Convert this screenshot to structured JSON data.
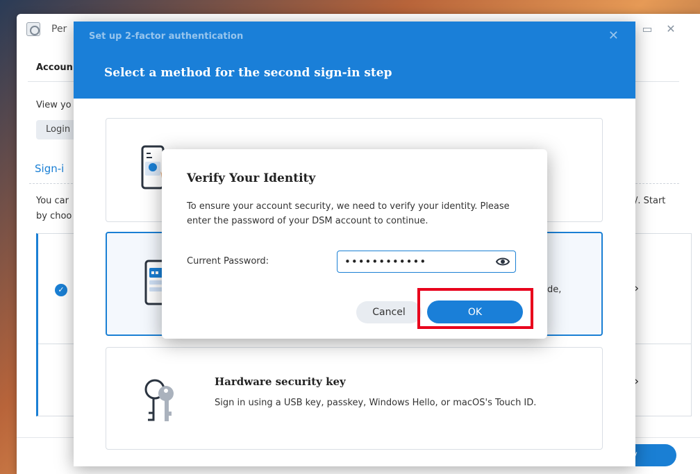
{
  "background_window": {
    "title": "Per",
    "tab": "Accoun",
    "view_text": "View yo",
    "chip": "Login",
    "section": "Sign-i",
    "desc_line1_left": "You car",
    "desc_line1_right": "/. Start",
    "desc_line2_left": "by choo",
    "apply_label": "y"
  },
  "dialog": {
    "supertitle": "Set up 2-factor authentication",
    "heading": "Select a method for the second sign-in step",
    "close_glyph": "✕",
    "cards": [
      {
        "title": "",
        "desc": ""
      },
      {
        "title": "",
        "desc_tail": "de,"
      },
      {
        "title": "Hardware security key",
        "desc": "Sign in using a USB key, passkey, Windows Hello, or macOS's Touch ID."
      }
    ]
  },
  "verify_modal": {
    "title": "Verify Your Identity",
    "body": "To ensure your account security, we need to verify your identity. Please enter the password of your DSM account to continue.",
    "password_label": "Current Password:",
    "password_value": "••••••••••••",
    "cancel_label": "Cancel",
    "ok_label": "OK"
  },
  "colors": {
    "accent": "#1a7fd8",
    "highlight": "#e8001c"
  },
  "icons": [
    "app-icon",
    "close-icon",
    "maximize-icon",
    "check-icon",
    "chevron-right-icon",
    "phone-icon",
    "tablet-icon",
    "keys-icon",
    "eye-icon"
  ]
}
